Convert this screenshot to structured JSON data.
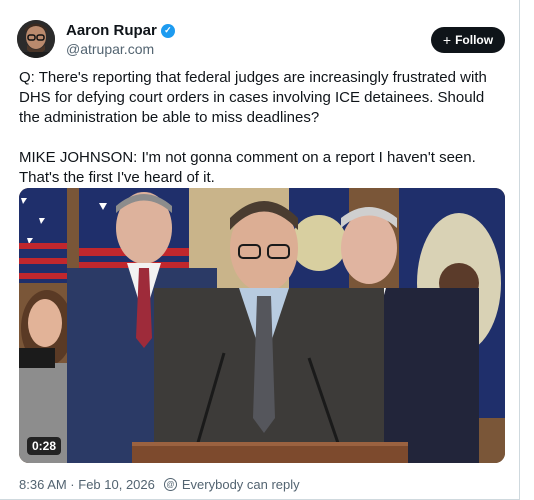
{
  "author": {
    "name": "Aaron Rupar",
    "handle": "@atrupar.com",
    "verified_icon": "verified-check-icon"
  },
  "follow_button": {
    "plus": "+",
    "label": "Follow"
  },
  "tweet": {
    "paragraph_1": "Q: There's reporting that federal judges are increasingly frustrated with DHS for defying court orders in cases involving ICE detainees. Should the administration be able to miss deadlines?",
    "paragraph_2": "MIKE JOHNSON: I'm not gonna comment on a report I haven't seen. That's the first I've heard of it."
  },
  "video": {
    "duration": "0:28"
  },
  "footer": {
    "timestamp": "8:36 AM · Feb 10, 2026",
    "reply_setting": "Everybody can reply",
    "reply_icon": "at-circle-icon"
  },
  "colors": {
    "follow_bg": "#0f1419",
    "verified_blue": "#1d9bf0",
    "muted_text": "#536471"
  }
}
